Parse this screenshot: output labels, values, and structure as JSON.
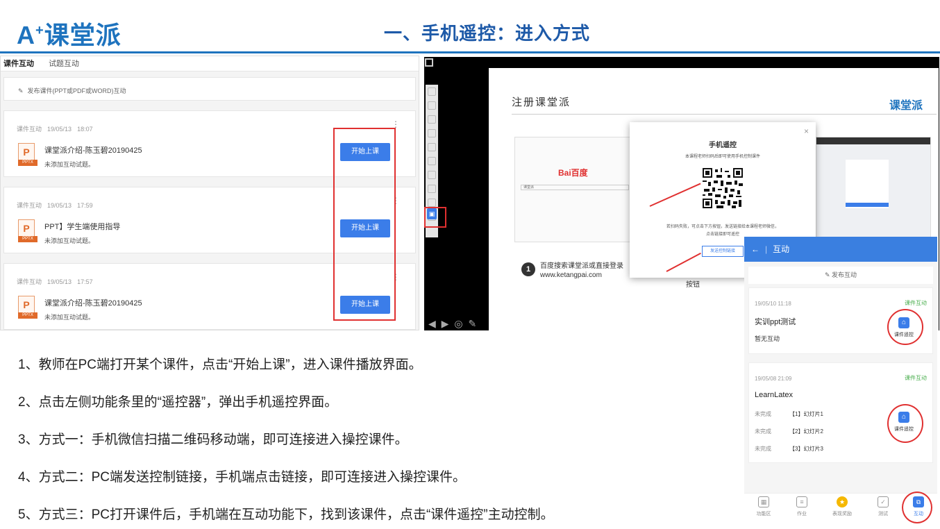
{
  "header": {
    "logo_mark": "A",
    "logo_plus": "+",
    "logo_text": "课堂派",
    "title": "一、手机遥控：进入方式"
  },
  "left_panel": {
    "tabs": [
      "课件互动",
      "试题互动"
    ],
    "publish_label": "发布课件(PPT或PDF或WORD)互动",
    "cards": [
      {
        "type": "课件互动",
        "date": "19/05/13",
        "time": "18:07",
        "file_icon": "P",
        "file_tag": "PPTX",
        "name": "课堂派介绍-陈玉碧20190425",
        "note": "未添加互动试题。",
        "button": "开始上课"
      },
      {
        "type": "课件互动",
        "date": "19/05/13",
        "time": "17:59",
        "file_icon": "P",
        "file_tag": "PPTX",
        "name": "PPT】学生端使用指导",
        "note": "未添加互动试题。",
        "button": "开始上课"
      },
      {
        "type": "课件互动",
        "date": "19/05/13",
        "time": "17:57",
        "file_icon": "P",
        "file_tag": "PPTX",
        "name": "课堂派介绍-陈玉碧20190425",
        "note": "未添加互动试题。",
        "button": "开始上课"
      }
    ]
  },
  "player": {
    "page_title": "注册课堂派",
    "page_logo": "课堂派",
    "baidu_logo": "Bai百度",
    "baidu_input": "课堂派",
    "step1_num": "1",
    "step1_line1": "百度搜索课堂派或直接登录",
    "step1_line2": "www.ketangpai.com",
    "step2_tail": "按钮",
    "remote_icon": "remote-control-icon",
    "modal": {
      "close": "×",
      "title": "手机遥控",
      "subtitle": "本课程老师扫码后即可使用手机控制课件",
      "fail_line1": "若扫码失败，可点击下方按钮，发送链接给本课程老师微信，",
      "fail_line2": "点击链接即可遥控",
      "send_button": "发送控制链接"
    }
  },
  "phone": {
    "back": "←",
    "title": "互动",
    "publish": "发布互动",
    "cards": [
      {
        "time": "19/05/10 11:18",
        "type": "课件互动",
        "title": "实训ppt测试",
        "note": "暂无互动",
        "remote_label": "课件遥控"
      },
      {
        "time": "19/05/08 21:09",
        "type": "课件互动",
        "title": "LearnLatex",
        "rows": [
          {
            "status": "未完成",
            "slide": "【1】幻灯片1"
          },
          {
            "status": "未完成",
            "slide": "【2】幻灯片2"
          },
          {
            "status": "未完成",
            "slide": "【3】幻灯片3"
          }
        ],
        "remote_label": "课件遥控"
      }
    ],
    "nav": [
      "功能区",
      "作业",
      "表现奖励",
      "测试",
      "互动"
    ]
  },
  "steps": [
    "1、教师在PC端打开某个课件，点击“开始上课”，进入课件播放界面。",
    "2、点击左侧功能条里的“遥控器”，弹出手机遥控界面。",
    "3、方式一：手机微信扫描二维码移动端，即可连接进入操控课件。",
    "4、方式二：PC端发送控制链接，手机端点击链接，即可连接进入操控课件。",
    "5、方式三：PC打开课件后，手机端在互动功能下，找到该课件，点击“课件遥控”主动控制。"
  ],
  "colors": {
    "brand_blue": "#1e73be",
    "button_blue": "#3b7de9",
    "highlight_red": "#e03030",
    "active_green": "#4caf50"
  }
}
